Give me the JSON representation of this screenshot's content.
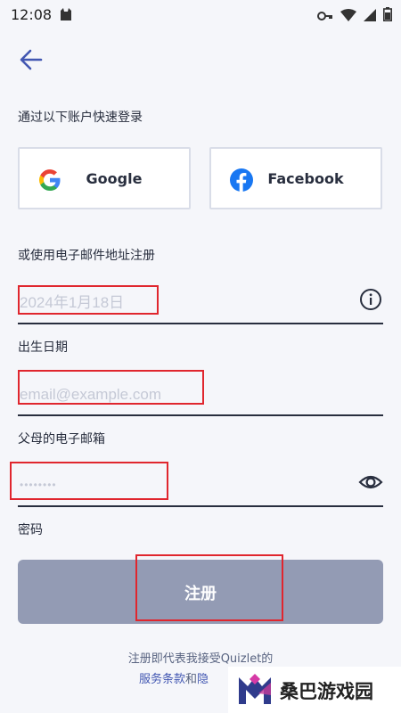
{
  "status_bar": {
    "time": "12:08"
  },
  "quick_login": {
    "title": "通过以下账户快速登录",
    "google_label": "Google",
    "facebook_label": "Facebook"
  },
  "email_signup": {
    "title": "或使用电子邮件地址注册"
  },
  "form": {
    "birthday": {
      "value": "2024年1月18日",
      "caption": "出生日期"
    },
    "parent_email": {
      "placeholder": "email@example.com",
      "caption": "父母的电子邮箱"
    },
    "password": {
      "value": "••••••••",
      "caption": "密码"
    }
  },
  "submit_label": "注册",
  "terms": {
    "line1": "注册即代表我接受Quizlet的",
    "service_terms": "服务条款",
    "and": "和",
    "privacy": "隐"
  },
  "watermark": {
    "text": "桑巴游戏园"
  },
  "colors": {
    "accent": "#4257b2",
    "button_disabled": "#939bb4",
    "annotation_red": "#e0262e"
  }
}
